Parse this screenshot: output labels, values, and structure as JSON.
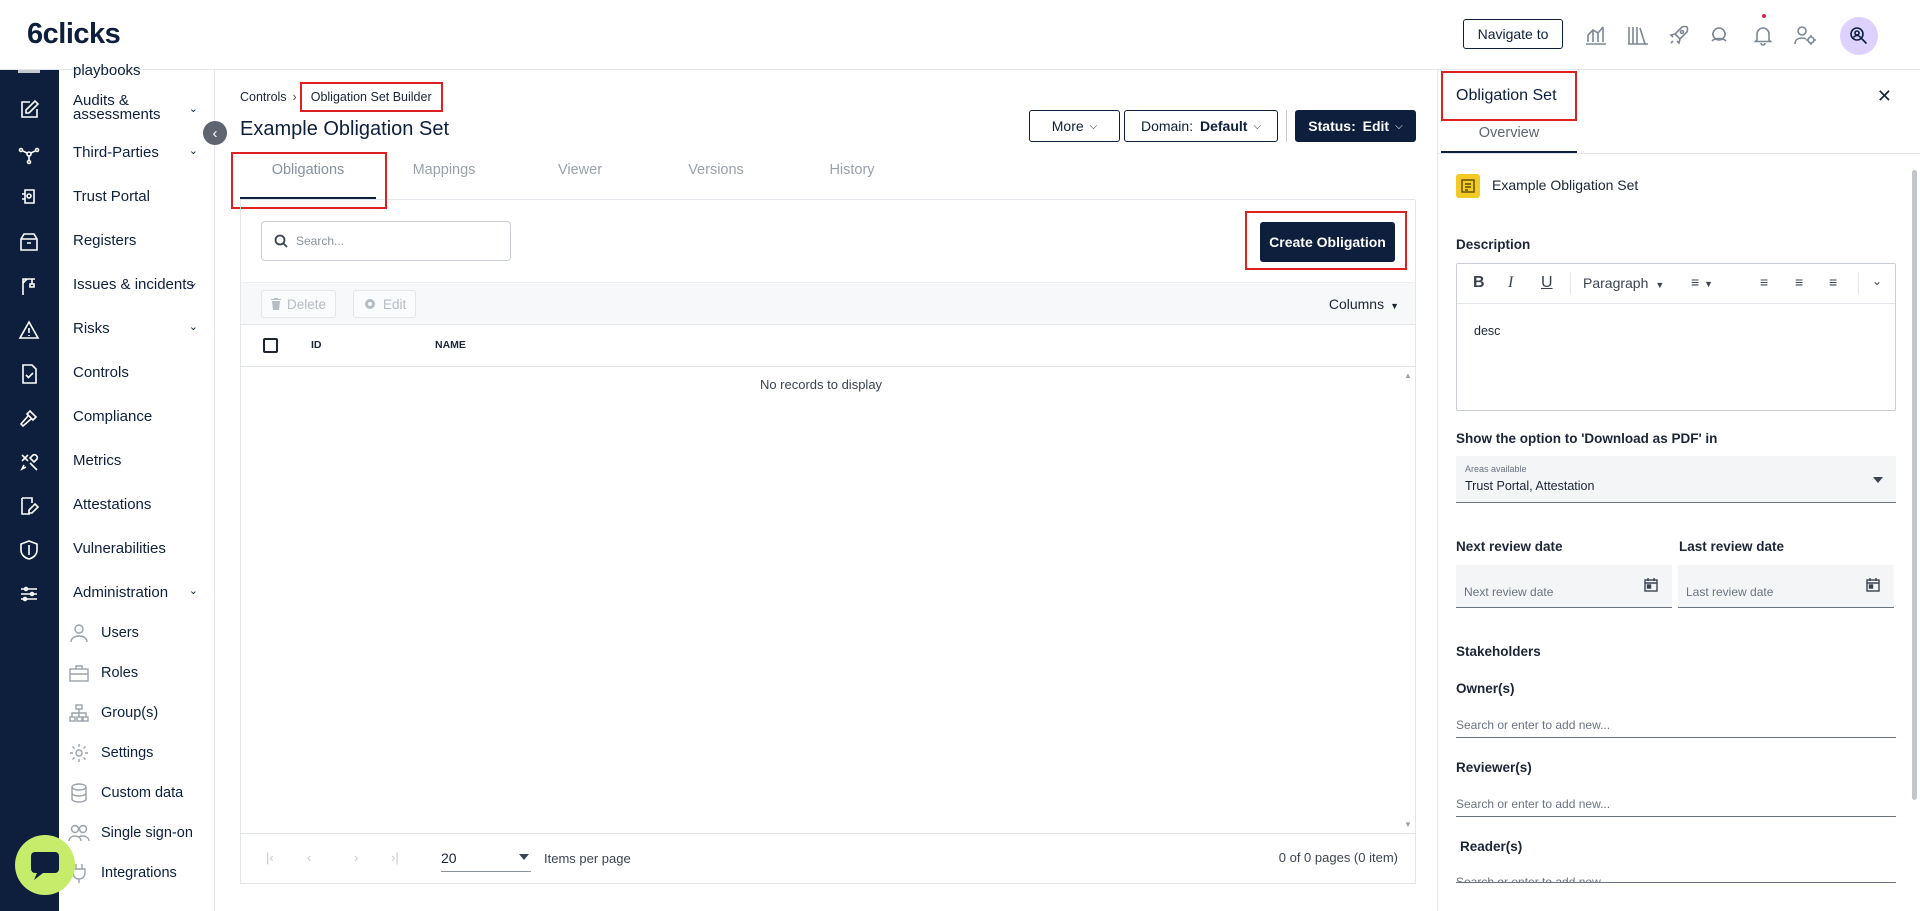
{
  "app": {
    "logo": "6clicks",
    "navigate_label": "Navigate to"
  },
  "topbar_icons": [
    "analytics-icon",
    "library-icon",
    "rocket-icon",
    "support-icon",
    "bell-icon",
    "user-settings-icon"
  ],
  "rail_icons": [
    "edit-icon",
    "network-icon",
    "portal-icon",
    "box-icon",
    "crane-icon",
    "warning-icon",
    "document-check-icon",
    "hammer-icon",
    "tools-icon",
    "signature-icon",
    "shield-icon",
    "sliders-icon"
  ],
  "sidebar": {
    "partial_top": "playbooks",
    "items": [
      {
        "label": "Audits &\nassessments",
        "chevron": true
      },
      {
        "label": "Third-Parties",
        "chevron": true
      },
      {
        "label": "Trust Portal",
        "chevron": false
      },
      {
        "label": "Registers",
        "chevron": false
      },
      {
        "label": "Issues & incidents",
        "chevron": true
      },
      {
        "label": "Risks",
        "chevron": true
      },
      {
        "label": "Controls",
        "chevron": false
      },
      {
        "label": "Compliance",
        "chevron": false
      },
      {
        "label": "Metrics",
        "chevron": false
      },
      {
        "label": "Attestations",
        "chevron": false
      },
      {
        "label": "Vulnerabilities",
        "chevron": false
      },
      {
        "label": "Administration",
        "chevron": true
      }
    ],
    "admin_items": [
      {
        "label": "Users",
        "icon": "user-icon"
      },
      {
        "label": "Roles",
        "icon": "briefcase-icon"
      },
      {
        "label": "Group(s)",
        "icon": "org-chart-icon"
      },
      {
        "label": "Settings",
        "icon": "gear-icon"
      },
      {
        "label": "Custom data",
        "icon": "database-icon"
      },
      {
        "label": "Single sign-on",
        "icon": "users-icon"
      },
      {
        "label": "Integrations",
        "icon": "plug-icon"
      }
    ]
  },
  "breadcrumb": {
    "parent": "Controls",
    "current": "Obligation Set Builder"
  },
  "page": {
    "title": "Example Obligation Set",
    "more_label": "More",
    "domain_prefix": "Domain: ",
    "domain_value": "Default",
    "status_prefix": "Status: ",
    "status_value": "Edit"
  },
  "tabs": [
    "Obligations",
    "Mappings",
    "Viewer",
    "Versions",
    "History"
  ],
  "grid": {
    "search_placeholder": "Search...",
    "create_label": "Create Obligation",
    "delete_label": "Delete",
    "edit_label": "Edit",
    "columns_label": "Columns",
    "headers": [
      "ID",
      "NAME"
    ],
    "empty_message": "No records to display",
    "per_page": "20",
    "items_per_page_label": "Items per page",
    "page_info": "0 of 0 pages (0 item)"
  },
  "right_panel": {
    "title": "Obligation Set",
    "tab": "Overview",
    "item_name": "Example Obligation Set",
    "description_label": "Description",
    "paragraph_label": "Paragraph",
    "description_text": "desc",
    "pdf_label": "Show the option to 'Download as PDF' in",
    "areas_small_label": "Areas available",
    "areas_value": "Trust Portal, Attestation",
    "next_review_label": "Next review date",
    "last_review_label": "Last review date",
    "next_review_placeholder": "Next review date",
    "last_review_placeholder": "Last review date",
    "stakeholders_label": "Stakeholders",
    "owners_label": "Owner(s)",
    "reviewers_label": "Reviewer(s)",
    "readers_label": "Reader(s)",
    "people_placeholder": "Search or enter to add new..."
  }
}
